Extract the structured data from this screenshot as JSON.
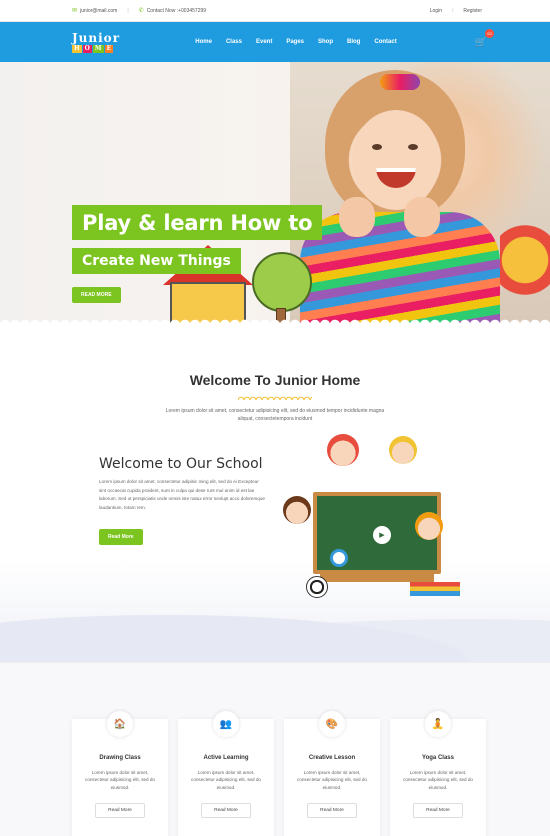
{
  "topbar": {
    "email": "junior@mail.com",
    "contact": "Contact Now :+003457299",
    "login": "Login",
    "register": "Register",
    "separator": "/"
  },
  "brand": {
    "logo_line1": "Junior",
    "logo_line2": [
      "H",
      "O",
      "M",
      "E"
    ],
    "logo_colors": [
      "#f1c232",
      "#e91e63",
      "#7cc41f",
      "#ff7f27"
    ]
  },
  "nav": {
    "items": [
      "Home",
      "Class",
      "Event",
      "Pages",
      "Shop",
      "Blog",
      "Contact"
    ],
    "cart_count": "03"
  },
  "hero": {
    "title": "Play & learn How to",
    "subtitle": "Create New Things",
    "button": "READ MORE"
  },
  "welcome": {
    "heading": "Welcome To Junior Home",
    "text": "Lorem ipsum dolor sit amet, consectetur adipisicing elit, sed do eiusmod tempor incididunte magna aliquat, consectetempora incidunt"
  },
  "school": {
    "heading": "Welcome to Our School",
    "text": "Lorem ipsum dolor sit amet, consectetur adipisic ming elit, sed do ei Excepteur sint occaecat cupida proident, sunt in culpa qui dese runt mul anim id est lae laborum. Sed ut perspiciatis unde omnis iste natux error sevlupt accu doloremque laudantium, totam rem.",
    "button": "Read More"
  },
  "features": [
    {
      "title": "Drawing Class",
      "text": "Lorem ipsum dolor sit amet, consectetur adipisicing elit, sed do eiusmod.",
      "button": "Read More",
      "icon": "drawing-icon",
      "color": "#7cc41f"
    },
    {
      "title": "Active Learning",
      "text": "Lorem ipsum dolor sit amet, consectetur adipisicing elit, sed do eiusmod.",
      "button": "Read More",
      "icon": "learning-icon",
      "color": "#e91e63"
    },
    {
      "title": "Creative Lesson",
      "text": "Lorem ipsum dolor sit amet, consectetur adipisicing elit, sed do eiusmod.",
      "button": "Read More",
      "icon": "creative-icon",
      "color": "#7b3fa0"
    },
    {
      "title": "Yoga Class",
      "text": "Lorem ipsum dolor sit amet, consectetur adipisicing elit, sed do eiusmod.",
      "button": "Read More",
      "icon": "yoga-icon",
      "color": "#f1a31b"
    }
  ],
  "colors": {
    "accent": "#7cc41f",
    "nav": "#1f9be0"
  }
}
